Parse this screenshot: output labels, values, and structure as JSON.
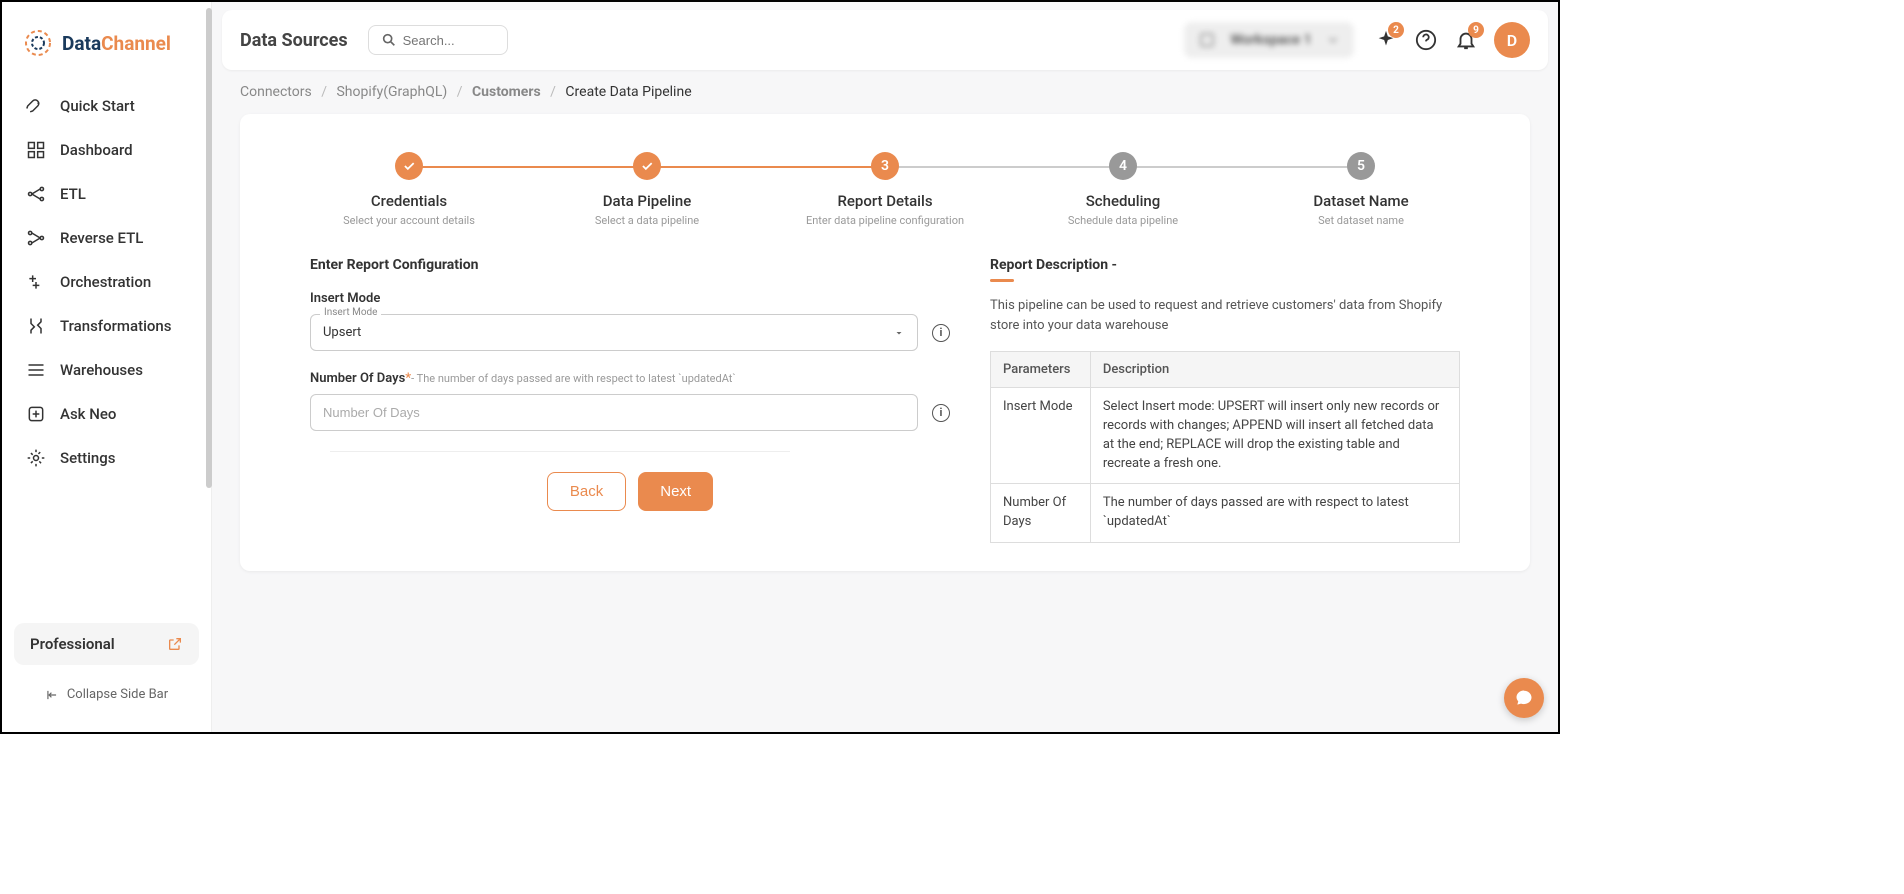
{
  "brand": {
    "part1": "Data",
    "part2": "Channel"
  },
  "nav": {
    "items": [
      {
        "label": "Quick Start"
      },
      {
        "label": "Dashboard"
      },
      {
        "label": "ETL"
      },
      {
        "label": "Reverse ETL"
      },
      {
        "label": "Orchestration"
      },
      {
        "label": "Transformations"
      },
      {
        "label": "Warehouses"
      },
      {
        "label": "Ask Neo"
      },
      {
        "label": "Settings"
      }
    ]
  },
  "plan": {
    "label": "Professional"
  },
  "collapse_label": "Collapse Side Bar",
  "header": {
    "page_title": "Data Sources",
    "search_placeholder": "Search...",
    "workspace": "Workspace 1",
    "sparkle_badge": "2",
    "bell_badge": "9",
    "avatar": "D"
  },
  "breadcrumb": {
    "items": [
      "Connectors",
      "Shopify(GraphQL)",
      "Customers",
      "Create Data Pipeline"
    ]
  },
  "steps": [
    {
      "title": "Credentials",
      "subtitle": "Select your account details",
      "state": "done"
    },
    {
      "title": "Data Pipeline",
      "subtitle": "Select a data pipeline",
      "state": "done"
    },
    {
      "title": "Report Details",
      "subtitle": "Enter data pipeline configuration",
      "state": "active",
      "num": "3"
    },
    {
      "title": "Scheduling",
      "subtitle": "Schedule data pipeline",
      "state": "pending",
      "num": "4"
    },
    {
      "title": "Dataset Name",
      "subtitle": "Set dataset name",
      "state": "pending",
      "num": "5"
    }
  ],
  "form": {
    "section_title": "Enter Report Configuration",
    "insert_mode_label": "Insert Mode",
    "insert_mode_float": "Insert Mode",
    "insert_mode_value": "Upsert",
    "num_days_label": "Number Of Days",
    "num_days_hint": "- The number of days passed are with respect to latest `updatedAt`",
    "num_days_placeholder": "Number Of Days",
    "back_btn": "Back",
    "next_btn": "Next"
  },
  "description": {
    "title": "Report Description -",
    "text": "This pipeline can be used to request and retrieve customers' data from Shopify store into your data warehouse",
    "table_headers": [
      "Parameters",
      "Description"
    ],
    "rows": [
      {
        "param": "Insert Mode",
        "desc": "Select Insert mode: UPSERT will insert only new records or records with changes; APPEND will insert all fetched data at the end; REPLACE will drop the existing table and recreate a fresh one."
      },
      {
        "param": "Number Of Days",
        "desc": "The number of days passed are with respect to latest `updatedAt`"
      }
    ]
  }
}
